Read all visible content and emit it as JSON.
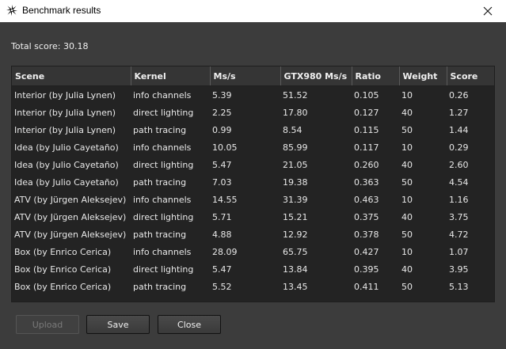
{
  "window": {
    "title": "Benchmark results"
  },
  "summary": {
    "total_score": "Total score: 30.18"
  },
  "table": {
    "columns": [
      "Scene",
      "Kernel",
      "Ms/s",
      "GTX980 Ms/s",
      "Ratio",
      "Weight",
      "Score"
    ],
    "rows": [
      [
        "Interior (by Julia Lynen)",
        "info channels",
        "5.39",
        "51.52",
        "0.105",
        "10",
        "0.26"
      ],
      [
        "Interior (by Julia Lynen)",
        "direct lighting",
        "2.25",
        "17.80",
        "0.127",
        "40",
        "1.27"
      ],
      [
        "Interior (by Julia Lynen)",
        "path tracing",
        "0.99",
        "8.54",
        "0.115",
        "50",
        "1.44"
      ],
      [
        "Idea (by Julio Cayetaño)",
        "info channels",
        "10.05",
        "85.99",
        "0.117",
        "10",
        "0.29"
      ],
      [
        "Idea (by Julio Cayetaño)",
        "direct lighting",
        "5.47",
        "21.05",
        "0.260",
        "40",
        "2.60"
      ],
      [
        "Idea (by Julio Cayetaño)",
        "path tracing",
        "7.03",
        "19.38",
        "0.363",
        "50",
        "4.54"
      ],
      [
        "ATV (by Jürgen Aleksejev)",
        "info channels",
        "14.55",
        "31.39",
        "0.463",
        "10",
        "1.16"
      ],
      [
        "ATV (by Jürgen Aleksejev)",
        "direct lighting",
        "5.71",
        "15.21",
        "0.375",
        "40",
        "3.75"
      ],
      [
        "ATV (by Jürgen Aleksejev)",
        "path tracing",
        "4.88",
        "12.92",
        "0.378",
        "50",
        "4.72"
      ],
      [
        "Box (by Enrico Cerica)",
        "info channels",
        "28.09",
        "65.75",
        "0.427",
        "10",
        "1.07"
      ],
      [
        "Box (by Enrico Cerica)",
        "direct lighting",
        "5.47",
        "13.84",
        "0.395",
        "40",
        "3.95"
      ],
      [
        "Box (by Enrico Cerica)",
        "path tracing",
        "5.52",
        "13.45",
        "0.411",
        "50",
        "5.13"
      ]
    ]
  },
  "buttons": {
    "upload": "Upload",
    "save": "Save",
    "close": "Close"
  },
  "icons": {
    "app": "octane-logo-icon",
    "close": "close-icon"
  }
}
